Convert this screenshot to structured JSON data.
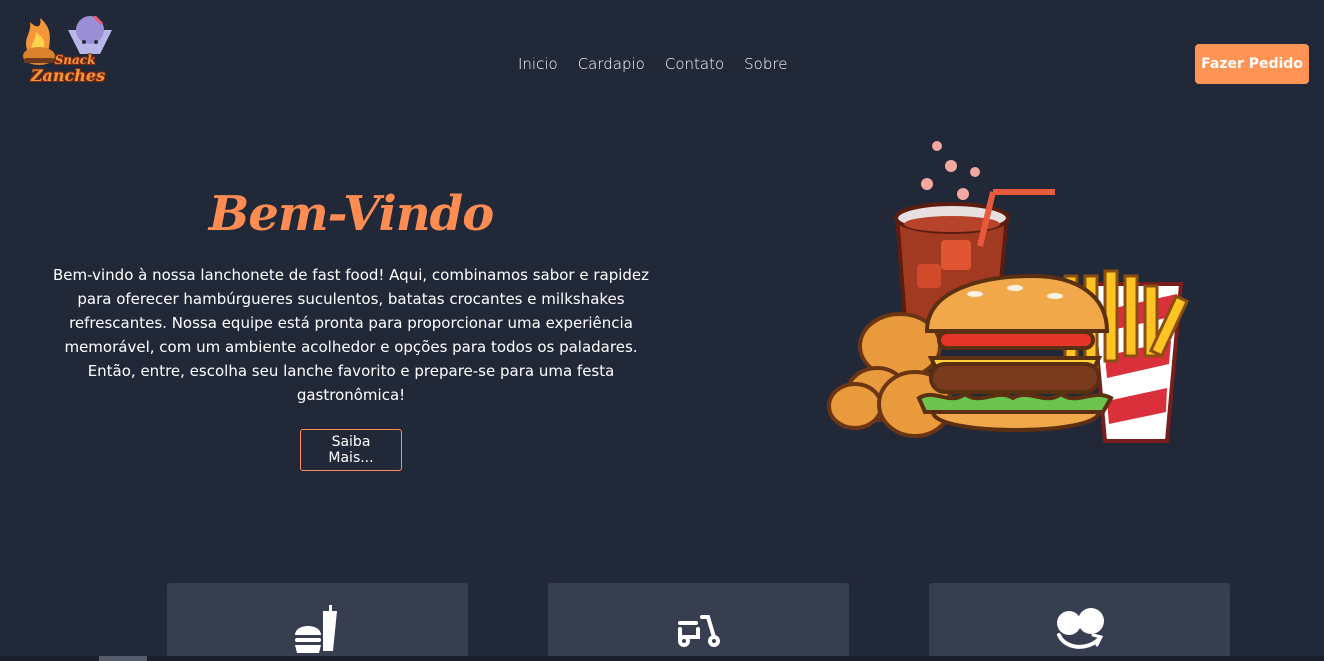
{
  "brand": {
    "line1": "Snack",
    "line2": "Zanches"
  },
  "nav": {
    "items": [
      "Inicio",
      "Cardapio",
      "Contato",
      "Sobre"
    ]
  },
  "header": {
    "order_label": "Fazer Pedido"
  },
  "hero": {
    "title": "Bem-Vindo",
    "text": "Bem-vindo à nossa lanchonete de fast food! Aqui, combinamos sabor e rapidez para oferecer hambúrgueres suculentos, batatas crocantes e milkshakes refrescantes. Nossa equipe está pronta para proporcionar uma experiência memorável, com um ambiente acolhedor e opções para todos os paladares. Então, entre, escolha seu lanche favorito e prepare-se para uma festa gastronômica!",
    "button_label": "Saiba Mais..."
  },
  "features": [
    {
      "icon": "burger-drink-icon"
    },
    {
      "icon": "delivery-scooter-icon"
    },
    {
      "icon": "happy-customer-icon"
    }
  ],
  "colors": {
    "accent": "#ff8c52",
    "button": "#ff9454",
    "background": "#212838",
    "card": "#363e50"
  }
}
